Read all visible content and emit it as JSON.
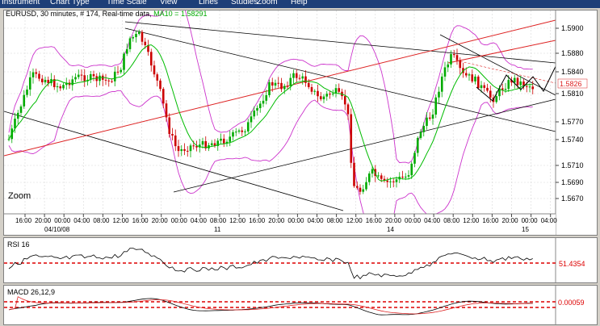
{
  "menu": {
    "items": [
      "Instrument",
      "Chart Type",
      "Time Scale",
      "View",
      "Lines",
      "Studies",
      "Zoom",
      "Help"
    ]
  },
  "main_chart": {
    "symbol": "EURUSD",
    "interval": "30 minutes",
    "bars": "# 174",
    "feed": "Real-time data",
    "ma_label": "MA10 =",
    "ma_value": "1.58291",
    "zoom_label": "Zoom",
    "price_ticks": [
      "1.5900",
      "1.5880",
      "1.5840",
      "1.5810",
      "1.5770",
      "1.5740",
      "1.5710",
      "1.5690",
      "1.5670"
    ],
    "current_price": "1.5826",
    "time_ticks": [
      "16:00",
      "20:00",
      "00:00",
      "04:00",
      "08:00",
      "12:00",
      "16:00",
      "20:00",
      "00:00",
      "04:00",
      "08:00",
      "12:00",
      "16:00",
      "20:00",
      "00:00",
      "04:00",
      "08:00",
      "12:00",
      "16:00",
      "20:00",
      "00:00",
      "04:00",
      "08:00",
      "12:00",
      "16:00",
      "20:00",
      "00:00",
      "04:00"
    ],
    "date_labels": [
      "04/10/08",
      "11",
      "14",
      "15"
    ]
  },
  "rsi": {
    "label": "RSI 16",
    "level": "51.4354"
  },
  "macd": {
    "label": "MACD 26,12,9",
    "level": "0.00059"
  },
  "colors": {
    "menubar": "#1e3f78",
    "candle_up": "#00aa00",
    "candle_down": "#cc0000",
    "ma": "#00bb00",
    "bollinger": "#cc33cc",
    "trend_red": "#dd2222",
    "level": "#dd0000"
  }
}
